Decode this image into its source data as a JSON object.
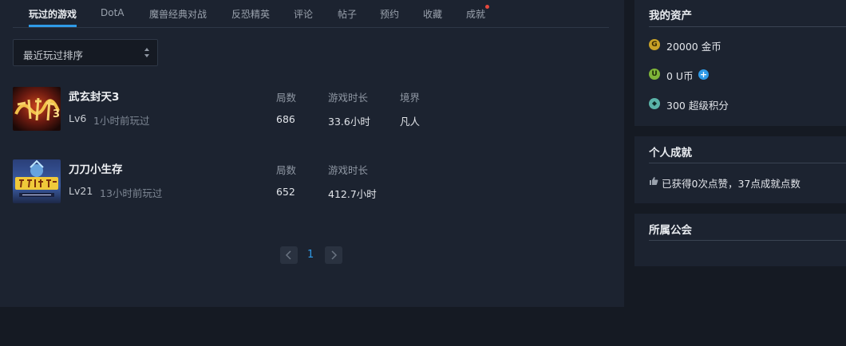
{
  "tabs": [
    {
      "label": "玩过的游戏",
      "active": true
    },
    {
      "label": "DotA"
    },
    {
      "label": "魔兽经典对战"
    },
    {
      "label": "反恐精英"
    },
    {
      "label": "评论"
    },
    {
      "label": "帖子"
    },
    {
      "label": "预约"
    },
    {
      "label": "收藏"
    },
    {
      "label": "成就",
      "has_notification": true
    }
  ],
  "sort": {
    "selected": "最近玩过排序"
  },
  "games": [
    {
      "name": "武玄封天3",
      "level": "Lv6",
      "last_played": "1小时前玩过",
      "cover_icon": "wuxuan-fengtian-cover",
      "stats": [
        {
          "header": "局数",
          "value": "686"
        },
        {
          "header": "游戏时长",
          "value": "33.6小时"
        },
        {
          "header": "境界",
          "value": "凡人"
        }
      ]
    },
    {
      "name": "刀刀小生存",
      "level": "Lv21",
      "last_played": "13小时前玩过",
      "cover_icon": "little-survival-cover",
      "stats": [
        {
          "header": "局数",
          "value": "652"
        },
        {
          "header": "游戏时长",
          "value": "412.7小时"
        }
      ]
    }
  ],
  "pagination": {
    "current": "1"
  },
  "assets": {
    "title": "我的资产",
    "gold": {
      "icon": "G",
      "text": "20000 金币"
    },
    "ucoin": {
      "icon": "U",
      "text": "0 U币"
    },
    "points": {
      "icon": "◆",
      "text": "300 超级积分"
    }
  },
  "achievements": {
    "title": "个人成就",
    "text": "已获得0次点赞，37点成就点数"
  },
  "guild": {
    "title": "所属公会"
  },
  "colors": {
    "accent": "#2f9ae6",
    "notification": "#e6483d",
    "gold_coin": "#c9a227",
    "u_coin": "#7fb539",
    "points_icon": "#5ab3a8"
  }
}
